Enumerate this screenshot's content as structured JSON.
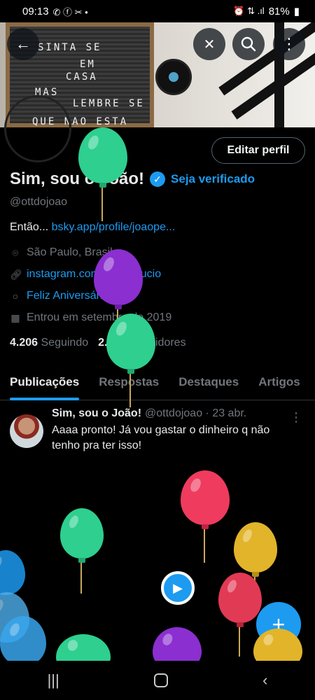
{
  "statusbar": {
    "time": "09:13",
    "battery": "81%",
    "left_icons": "✆ ⓕ ✂ •",
    "right_icons": "⏰ ⇅ .ıl"
  },
  "banner": {
    "board_lines": [
      "SINTA SE",
      "EM",
      "CASA",
      "MAS",
      "LEMBRE SE",
      "QUE NAO ESTA"
    ]
  },
  "profile": {
    "edit_label": "Editar perfil",
    "display_name": "Sim, sou o João!",
    "verify_label": "Seja verificado",
    "handle": "@ottdojoao",
    "bio_prefix": "Então...",
    "bio_link": "bsky.app/profile/joaope...",
    "location": "São Paulo, Brasil",
    "website": "instagram.com/joaoperucio",
    "birthday": "Feliz Aniversário!",
    "joined": "Entrou em setembro de 2019",
    "following_count": "4.206",
    "following_label": "Seguindo",
    "followers_count": "2.145",
    "followers_label": "Seguidores"
  },
  "tabs": [
    {
      "label": "Publicações",
      "active": true
    },
    {
      "label": "Respostas"
    },
    {
      "label": "Destaques"
    },
    {
      "label": "Artigos"
    }
  ],
  "post": {
    "name": "Sim, sou o João!",
    "meta": "@ottdojoao · 23 abr.",
    "text": "Aaaa pronto! Já vou gastar o dinheiro q não tenho pra ter isso!"
  },
  "icons": {
    "back": "back-arrow-icon",
    "grok": "grok-icon",
    "search": "search-icon",
    "more": "more-vertical-icon",
    "location": "location-icon",
    "link": "link-icon",
    "balloon": "balloon-icon",
    "calendar": "calendar-icon",
    "verified": "verified-badge-icon",
    "play": "play-icon",
    "compose": "plus-icon"
  },
  "colors": {
    "accent": "#1d9bf0",
    "background": "#000000",
    "muted": "#71767b"
  }
}
